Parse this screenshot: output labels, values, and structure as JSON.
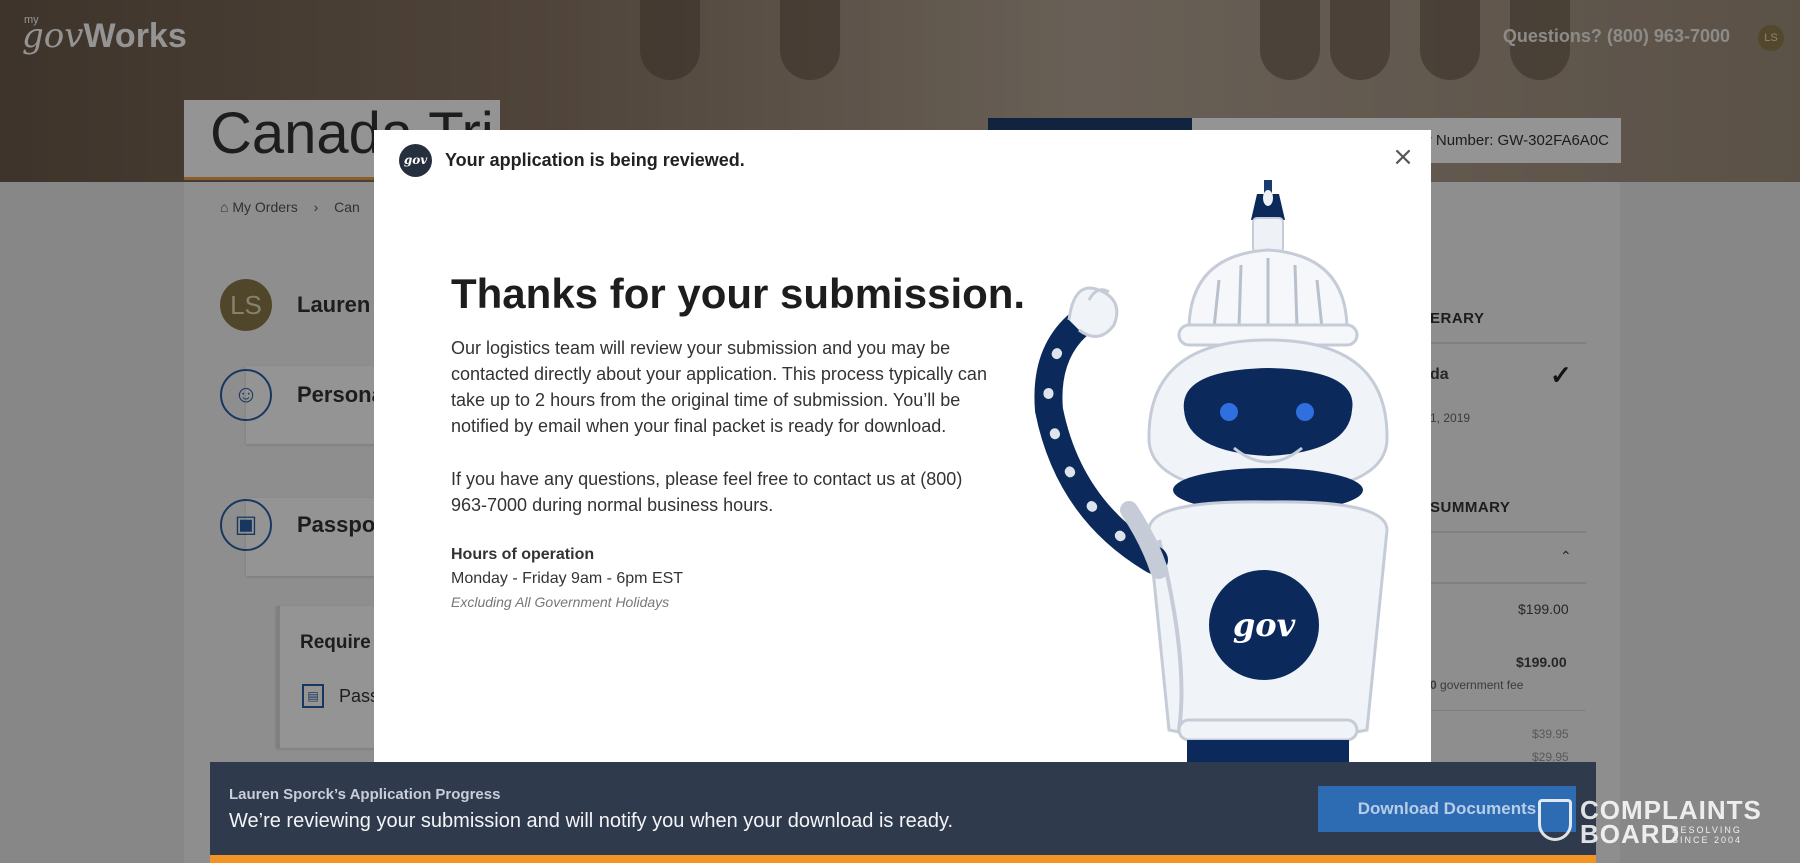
{
  "header": {
    "logo_prefix": "my",
    "logo_gov": "gov",
    "logo_works": "Works",
    "questions": "Questions?  (800) 963-7000",
    "user_initials": "LS",
    "country_title": "Canada Tri",
    "order_number": "Order Number: GW-302FA6A0C"
  },
  "breadcrumb": {
    "home": "My Orders",
    "current": "Can"
  },
  "user": {
    "initials": "LS",
    "name": "Lauren S"
  },
  "sections": [
    {
      "label": "Persona"
    },
    {
      "label": "Passpor"
    }
  ],
  "requirements": {
    "title": "Require",
    "item": "Pass"
  },
  "sidebar": {
    "itinerary_heading": "ERARY",
    "itinerary_item": "da",
    "itinerary_date": "1, 2019",
    "summary_heading": "SUMMARY",
    "line1_price": "$199.00",
    "line2_price": "$199.00",
    "gov_fee_prefix": "0",
    "gov_fee_label": "government fee",
    "fee1": "$39.95",
    "fee2": "$29.95"
  },
  "modal": {
    "badge": "gov",
    "header": "Your application is being reviewed.",
    "close": "×",
    "title": "Thanks for your submission.",
    "paragraph1": "Our logistics team will review your submission and you may be contacted directly about your application. This process typically can take up to 2 hours from the original time of submission. You’ll be notified by email when your final packet is ready for download.",
    "paragraph2": "If you have any questions, please feel free to contact us at (800) 963-7000 during normal business hours.",
    "hours_title": "Hours of operation",
    "hours": "Monday - Friday 9am - 6pm EST",
    "hours_note": "Excluding All Government Holidays",
    "robot_badge": "gov"
  },
  "progress": {
    "title": "Lauren Sporck’s Application Progress",
    "message": "We’re reviewing your submission and will notify you when your download is ready.",
    "button": "Download Documents"
  },
  "watermark": {
    "line1": "COMPLAINTS",
    "line2": "BOARD",
    "tagline": "RESOLVING SINCE 2004"
  },
  "colors": {
    "navy": "#0b2a5b",
    "accent_orange": "#f29325",
    "button_blue": "#2d6bb3",
    "progress_bg": "#2f3a4c"
  }
}
